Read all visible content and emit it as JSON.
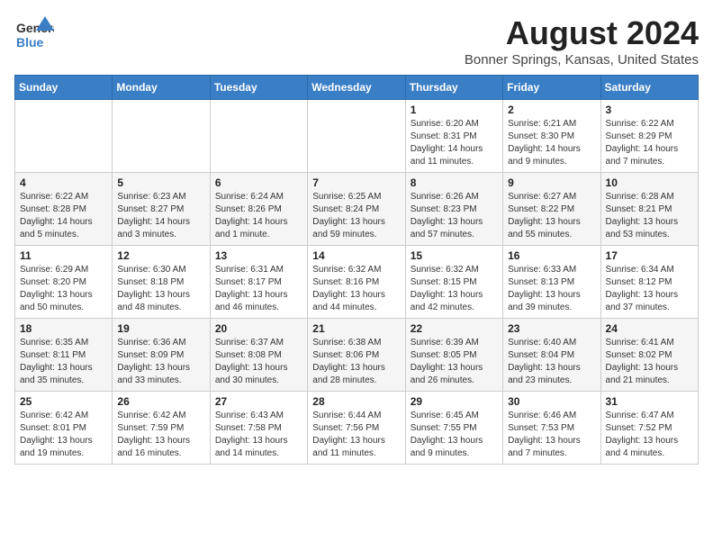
{
  "header": {
    "logo_line1": "General",
    "logo_line2": "Blue",
    "main_title": "August 2024",
    "subtitle": "Bonner Springs, Kansas, United States"
  },
  "calendar": {
    "days_of_week": [
      "Sunday",
      "Monday",
      "Tuesday",
      "Wednesday",
      "Thursday",
      "Friday",
      "Saturday"
    ],
    "weeks": [
      [
        {
          "day": "",
          "info": ""
        },
        {
          "day": "",
          "info": ""
        },
        {
          "day": "",
          "info": ""
        },
        {
          "day": "",
          "info": ""
        },
        {
          "day": "1",
          "info": "Sunrise: 6:20 AM\nSunset: 8:31 PM\nDaylight: 14 hours and 11 minutes."
        },
        {
          "day": "2",
          "info": "Sunrise: 6:21 AM\nSunset: 8:30 PM\nDaylight: 14 hours and 9 minutes."
        },
        {
          "day": "3",
          "info": "Sunrise: 6:22 AM\nSunset: 8:29 PM\nDaylight: 14 hours and 7 minutes."
        }
      ],
      [
        {
          "day": "4",
          "info": "Sunrise: 6:22 AM\nSunset: 8:28 PM\nDaylight: 14 hours and 5 minutes."
        },
        {
          "day": "5",
          "info": "Sunrise: 6:23 AM\nSunset: 8:27 PM\nDaylight: 14 hours and 3 minutes."
        },
        {
          "day": "6",
          "info": "Sunrise: 6:24 AM\nSunset: 8:26 PM\nDaylight: 14 hours and 1 minute."
        },
        {
          "day": "7",
          "info": "Sunrise: 6:25 AM\nSunset: 8:24 PM\nDaylight: 13 hours and 59 minutes."
        },
        {
          "day": "8",
          "info": "Sunrise: 6:26 AM\nSunset: 8:23 PM\nDaylight: 13 hours and 57 minutes."
        },
        {
          "day": "9",
          "info": "Sunrise: 6:27 AM\nSunset: 8:22 PM\nDaylight: 13 hours and 55 minutes."
        },
        {
          "day": "10",
          "info": "Sunrise: 6:28 AM\nSunset: 8:21 PM\nDaylight: 13 hours and 53 minutes."
        }
      ],
      [
        {
          "day": "11",
          "info": "Sunrise: 6:29 AM\nSunset: 8:20 PM\nDaylight: 13 hours and 50 minutes."
        },
        {
          "day": "12",
          "info": "Sunrise: 6:30 AM\nSunset: 8:18 PM\nDaylight: 13 hours and 48 minutes."
        },
        {
          "day": "13",
          "info": "Sunrise: 6:31 AM\nSunset: 8:17 PM\nDaylight: 13 hours and 46 minutes."
        },
        {
          "day": "14",
          "info": "Sunrise: 6:32 AM\nSunset: 8:16 PM\nDaylight: 13 hours and 44 minutes."
        },
        {
          "day": "15",
          "info": "Sunrise: 6:32 AM\nSunset: 8:15 PM\nDaylight: 13 hours and 42 minutes."
        },
        {
          "day": "16",
          "info": "Sunrise: 6:33 AM\nSunset: 8:13 PM\nDaylight: 13 hours and 39 minutes."
        },
        {
          "day": "17",
          "info": "Sunrise: 6:34 AM\nSunset: 8:12 PM\nDaylight: 13 hours and 37 minutes."
        }
      ],
      [
        {
          "day": "18",
          "info": "Sunrise: 6:35 AM\nSunset: 8:11 PM\nDaylight: 13 hours and 35 minutes."
        },
        {
          "day": "19",
          "info": "Sunrise: 6:36 AM\nSunset: 8:09 PM\nDaylight: 13 hours and 33 minutes."
        },
        {
          "day": "20",
          "info": "Sunrise: 6:37 AM\nSunset: 8:08 PM\nDaylight: 13 hours and 30 minutes."
        },
        {
          "day": "21",
          "info": "Sunrise: 6:38 AM\nSunset: 8:06 PM\nDaylight: 13 hours and 28 minutes."
        },
        {
          "day": "22",
          "info": "Sunrise: 6:39 AM\nSunset: 8:05 PM\nDaylight: 13 hours and 26 minutes."
        },
        {
          "day": "23",
          "info": "Sunrise: 6:40 AM\nSunset: 8:04 PM\nDaylight: 13 hours and 23 minutes."
        },
        {
          "day": "24",
          "info": "Sunrise: 6:41 AM\nSunset: 8:02 PM\nDaylight: 13 hours and 21 minutes."
        }
      ],
      [
        {
          "day": "25",
          "info": "Sunrise: 6:42 AM\nSunset: 8:01 PM\nDaylight: 13 hours and 19 minutes."
        },
        {
          "day": "26",
          "info": "Sunrise: 6:42 AM\nSunset: 7:59 PM\nDaylight: 13 hours and 16 minutes."
        },
        {
          "day": "27",
          "info": "Sunrise: 6:43 AM\nSunset: 7:58 PM\nDaylight: 13 hours and 14 minutes."
        },
        {
          "day": "28",
          "info": "Sunrise: 6:44 AM\nSunset: 7:56 PM\nDaylight: 13 hours and 11 minutes."
        },
        {
          "day": "29",
          "info": "Sunrise: 6:45 AM\nSunset: 7:55 PM\nDaylight: 13 hours and 9 minutes."
        },
        {
          "day": "30",
          "info": "Sunrise: 6:46 AM\nSunset: 7:53 PM\nDaylight: 13 hours and 7 minutes."
        },
        {
          "day": "31",
          "info": "Sunrise: 6:47 AM\nSunset: 7:52 PM\nDaylight: 13 hours and 4 minutes."
        }
      ]
    ]
  }
}
